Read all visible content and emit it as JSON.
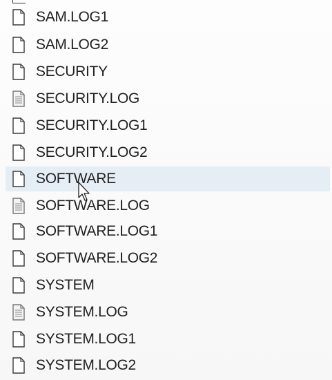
{
  "files": [
    {
      "name": "SAM.LOG1",
      "icon": "blank-file-icon"
    },
    {
      "name": "SAM.LOG2",
      "icon": "blank-file-icon"
    },
    {
      "name": "SECURITY",
      "icon": "blank-file-icon"
    },
    {
      "name": "SECURITY.LOG",
      "icon": "text-file-icon"
    },
    {
      "name": "SECURITY.LOG1",
      "icon": "blank-file-icon"
    },
    {
      "name": "SECURITY.LOG2",
      "icon": "blank-file-icon"
    },
    {
      "name": "SOFTWARE",
      "icon": "blank-file-icon",
      "selected": true
    },
    {
      "name": "SOFTWARE.LOG",
      "icon": "text-file-icon"
    },
    {
      "name": "SOFTWARE.LOG1",
      "icon": "blank-file-icon"
    },
    {
      "name": "SOFTWARE.LOG2",
      "icon": "blank-file-icon"
    },
    {
      "name": "SYSTEM",
      "icon": "blank-file-icon"
    },
    {
      "name": "SYSTEM.LOG",
      "icon": "text-file-icon"
    },
    {
      "name": "SYSTEM.LOG1",
      "icon": "blank-file-icon"
    },
    {
      "name": "SYSTEM.LOG2",
      "icon": "blank-file-icon"
    }
  ],
  "colors": {
    "selection": "#e6eef5",
    "text": "#1f1f1f"
  }
}
